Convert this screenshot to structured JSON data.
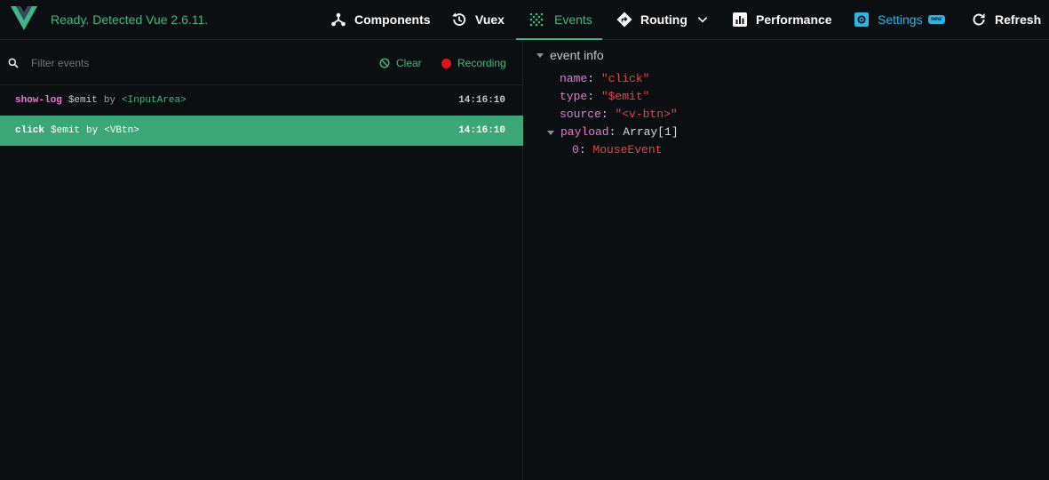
{
  "status_text": "Ready. Detected Vue 2.6.11.",
  "nav": {
    "components": "Components",
    "vuex": "Vuex",
    "events": "Events",
    "routing": "Routing",
    "performance": "Performance",
    "settings": "Settings",
    "settings_badge": "new",
    "refresh": "Refresh"
  },
  "toolbar": {
    "filter_placeholder": "Filter events",
    "clear_label": "Clear",
    "recording_label": "Recording"
  },
  "events": [
    {
      "name": "show-log",
      "type": "$emit",
      "by": "by",
      "component": "<InputArea>",
      "time": "14:16:10",
      "selected": false
    },
    {
      "name": "click",
      "type": "$emit",
      "by": "by",
      "component": "<VBtn>",
      "time": "14:16:10",
      "selected": true
    }
  ],
  "details": {
    "section_title": "event info",
    "name_key": "name",
    "name_value": "\"click\"",
    "type_key": "type",
    "type_value": "\"$emit\"",
    "source_key": "source",
    "source_value": "\"<v-btn>\"",
    "payload_key": "payload",
    "payload_value": "Array[1]",
    "payload_item_key": "0",
    "payload_item_value": "MouseEvent"
  },
  "colors": {
    "accent": "#41b883",
    "settings": "#29b6e6",
    "selected_row": "#3ba776",
    "record": "#e0141a",
    "background": "#0b0f12"
  }
}
